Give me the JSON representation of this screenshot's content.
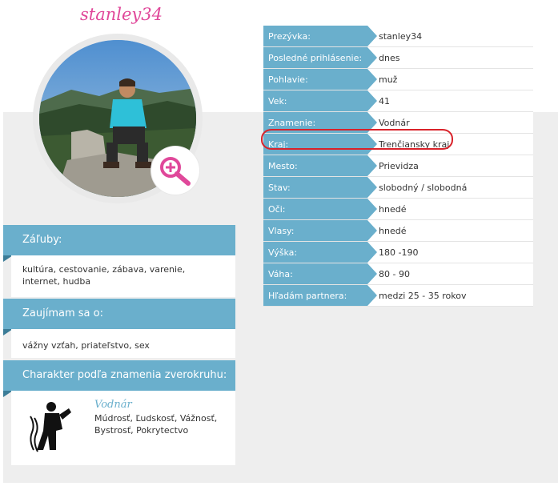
{
  "profile": {
    "username": "stanley34"
  },
  "fields": [
    {
      "label": "Prezývka:",
      "value": "stanley34"
    },
    {
      "label": "Posledné prihlásenie:",
      "value": "dnes"
    },
    {
      "label": "Pohlavie:",
      "value": "muž"
    },
    {
      "label": "Vek:",
      "value": "41"
    },
    {
      "label": "Znamenie:",
      "value": "Vodnár"
    },
    {
      "label": "Kraj:",
      "value": "Trenčiansky kraj"
    },
    {
      "label": "Mesto:",
      "value": "Prievidza"
    },
    {
      "label": "Stav:",
      "value": "slobodný / slobodná"
    },
    {
      "label": "Oči:",
      "value": "hnedé"
    },
    {
      "label": "Vlasy:",
      "value": "hnedé"
    },
    {
      "label": "Výška:",
      "value": "180 -190"
    },
    {
      "label": "Váha:",
      "value": "80 - 90"
    },
    {
      "label": "Hľadám partnera:",
      "value": "medzi 25 - 35 rokov"
    }
  ],
  "panels": {
    "hobbies": {
      "title": "Záľuby:",
      "text": "kultúra, cestovanie, zábava, varenie, internet, hudba"
    },
    "interests": {
      "title": "Zaujímam sa o:",
      "text": "vážny vzťah, priateľstvo, sex"
    },
    "zodiac": {
      "title": "Charakter podľa znamenia zverokruhu:",
      "sign": "Vodnár",
      "traits": "Múdrosť, Ľudskosť, Vážnosť, Bystrosť, Pokrytectvo"
    }
  },
  "icons": {
    "zoom": "zoom-in-icon",
    "zodiac": "aquarius-icon"
  },
  "colors": {
    "accent": "#6aafcc",
    "username": "#e0489a",
    "highlight": "#d9222a",
    "zoom": "#e0489a"
  }
}
